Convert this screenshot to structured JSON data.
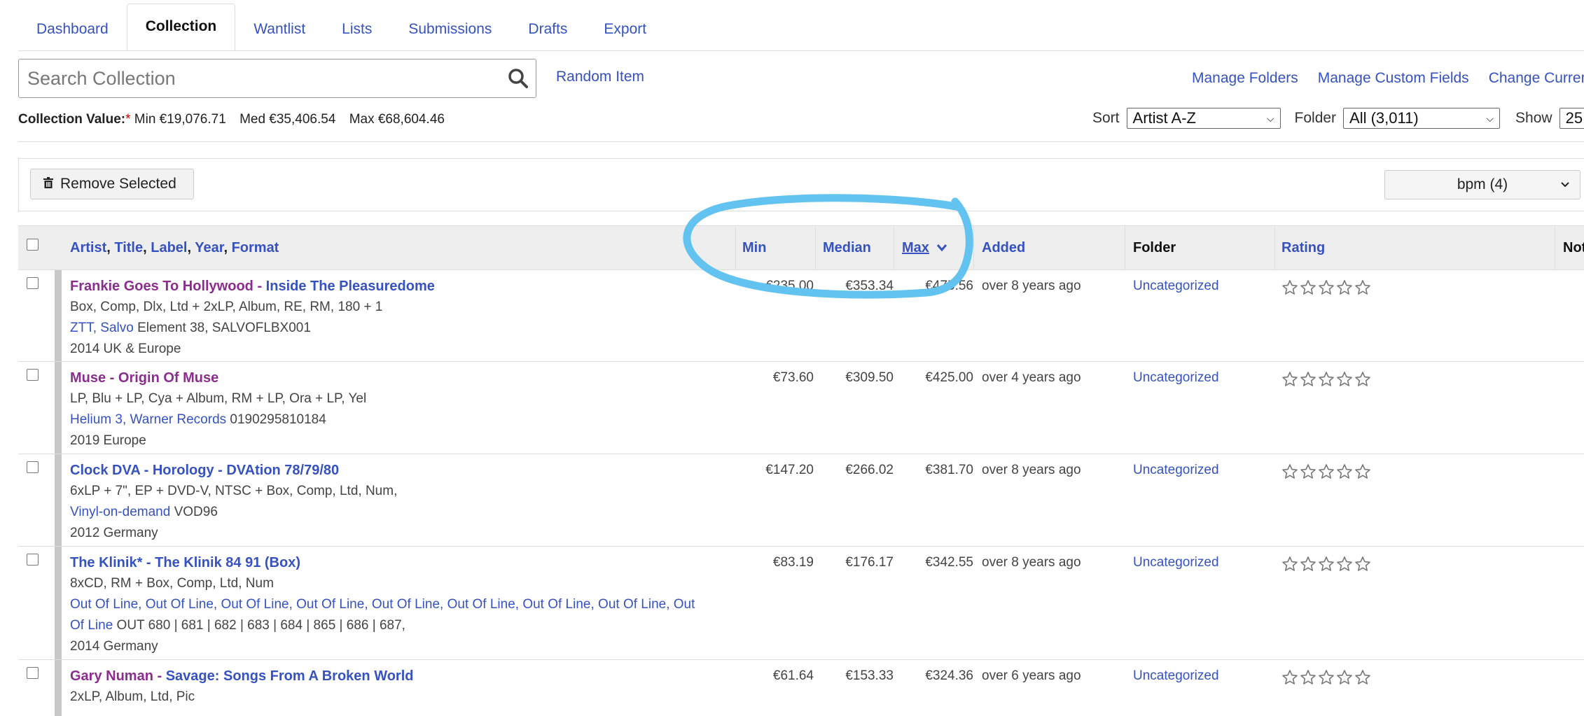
{
  "tabs": [
    "Dashboard",
    "Collection",
    "Wantlist",
    "Lists",
    "Submissions",
    "Drafts",
    "Export"
  ],
  "search": {
    "placeholder": "Search Collection",
    "random_label": "Random Item"
  },
  "top_links": [
    "Manage Folders",
    "Manage Custom Fields",
    "Change Currenc"
  ],
  "collection_value": {
    "label": "Collection Value:",
    "asterisk": "*",
    "min": "Min €19,076.71",
    "med": "Med €35,406.54",
    "max": "Max €68,604.46"
  },
  "sort": {
    "sort_label": "Sort",
    "sort_value": "Artist A-Z",
    "folder_label": "Folder",
    "folder_value": "All (3,011)",
    "show_label": "Show",
    "show_value": "25"
  },
  "actions": {
    "remove_label": "Remove Selected",
    "bpm_label": "bpm (4)"
  },
  "columns": {
    "artist": "Artist",
    "title": "Title",
    "label": "Label",
    "year": "Year",
    "format": "Format",
    "min": "Min",
    "median": "Median",
    "max": "Max",
    "added": "Added",
    "folder": "Folder",
    "rating": "Rating",
    "notes": "Not"
  },
  "rows": [
    {
      "artist": "Frankie Goes To Hollywood",
      "title": "Inside The Pleasuredome",
      "format": "Box, Comp, Dlx, Ltd + 2xLP, Album, RE, RM, 180 + 1",
      "labels": "ZTT, Salvo",
      "catno": " Element 38, SALVOFLBX001",
      "year_country": "2014 UK & Europe",
      "min": "€235.00",
      "median": "€353.34",
      "max": "€475.56",
      "added": "over 8 years ago",
      "folder": "Uncategorized"
    },
    {
      "artist": "Muse",
      "title": "Origin Of Muse",
      "format": "LP, Blu + LP, Cya + Album, RM + LP, Ora + LP, Yel",
      "labels": "Helium 3, Warner Records",
      "catno": " 0190295810184",
      "year_country": "2019 Europe",
      "min": "€73.60",
      "median": "€309.50",
      "max": "€425.00",
      "added": "over 4 years ago",
      "folder": "Uncategorized"
    },
    {
      "artist": "Clock DVA",
      "title": "Horology - DVAtion 78/79/80",
      "format": "6xLP + 7\", EP + DVD-V, NTSC + Box, Comp, Ltd, Num,",
      "labels": "Vinyl-on-demand",
      "catno": " VOD96",
      "year_country": "2012 Germany",
      "min": "€147.20",
      "median": "€266.02",
      "max": "€381.70",
      "added": "over 8 years ago",
      "folder": "Uncategorized"
    },
    {
      "artist": "The Klinik*",
      "title": "The Klinik 84 91 (Box)",
      "format": "8xCD, RM + Box, Comp, Ltd, Num",
      "labels_line1": "Out Of Line, Out Of Line, Out Of Line, Out Of Line, Out Of Line, Out Of Line, Out Of Line, Out Of Line, Out",
      "labels_line2": "Of Line",
      "catno": " OUT 680 | 681 | 682 | 683 | 684 | 865 | 686 | 687,",
      "year_country": "2014 Germany",
      "min": "€83.19",
      "median": "€176.17",
      "max": "€342.55",
      "added": "over 8 years ago",
      "folder": "Uncategorized"
    },
    {
      "artist": "Gary Numan",
      "title": "Savage: Songs From A Broken World",
      "format": "2xLP, Album, Ltd, Pic",
      "min": "€61.64",
      "median": "€153.33",
      "max": "€324.36",
      "added": "over 6 years ago",
      "folder": "Uncategorized"
    }
  ],
  "colors": {
    "link": "#3552c0",
    "artist": "#8b2c8f",
    "annotation": "#62c3f0"
  }
}
